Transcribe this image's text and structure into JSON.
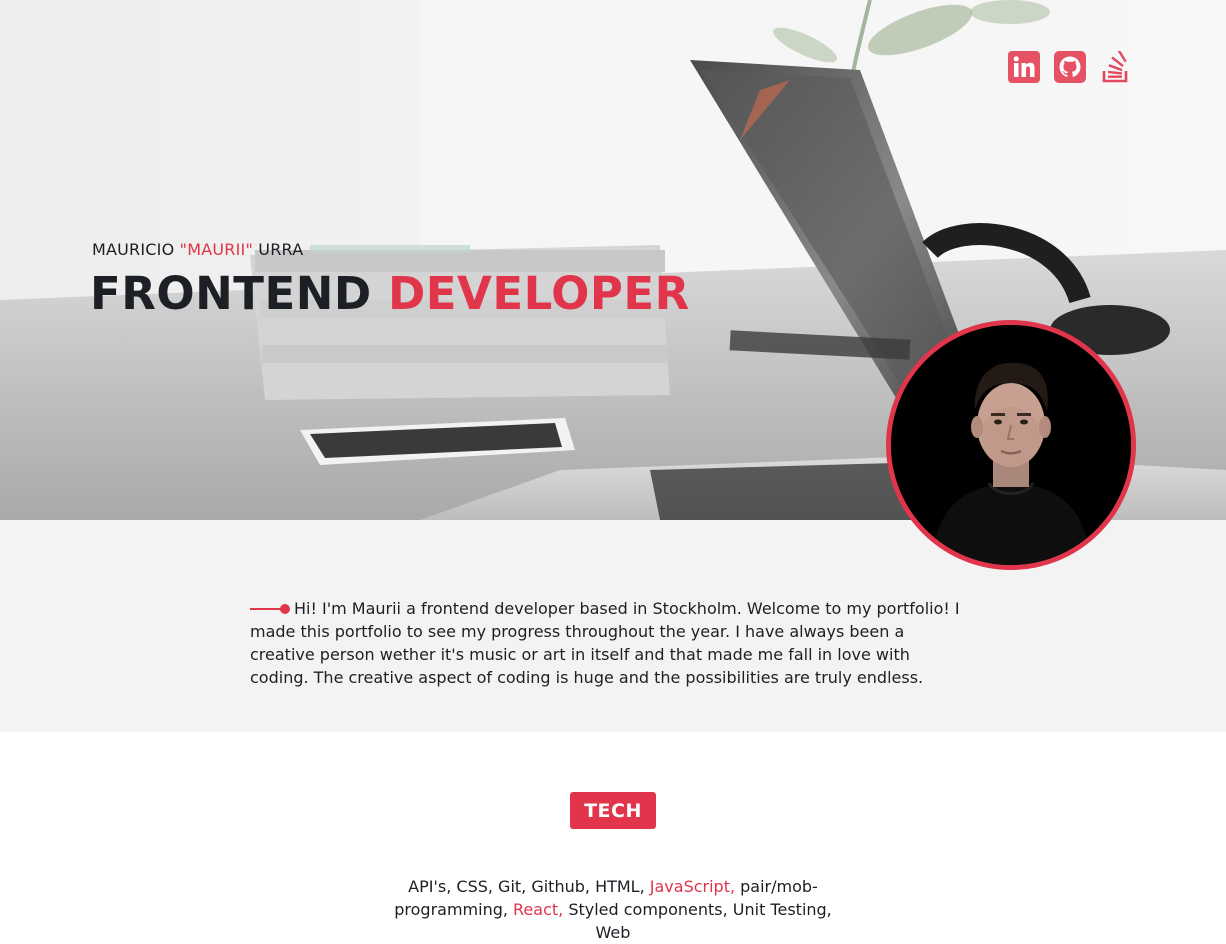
{
  "hero": {
    "name_first": "MAURICIO ",
    "name_nick": "\"MAURII\"",
    "name_last": " URRA",
    "title_main": "FRONTEND ",
    "title_accent": "DEVELOPER"
  },
  "social": [
    {
      "name": "linkedin",
      "icon": "linkedin-icon"
    },
    {
      "name": "github",
      "icon": "github-icon"
    },
    {
      "name": "stackoverflow",
      "icon": "stackoverflow-icon"
    }
  ],
  "about": {
    "text": "Hi! I'm Maurii a frontend developer based in Stockholm. Welcome to my portfolio! I made this portfolio to see my progress throughout the year. I have always been a creative person wether it's music or art in itself and that made me fall in love with coding. The creative aspect of coding is huge and the possibilities are truly endless."
  },
  "tech": {
    "heading": "TECH",
    "items_1": "API's, CSS, Git, Github, HTML, ",
    "highlight_1": "JavaScript,",
    "items_2": " pair/mob-programming, ",
    "highlight_2": "React,",
    "items_3": " Styled components, Unit Testing, Web"
  },
  "colors": {
    "accent": "#e0354a",
    "text": "#1c1f24",
    "about_bg": "#f3f3f3"
  }
}
